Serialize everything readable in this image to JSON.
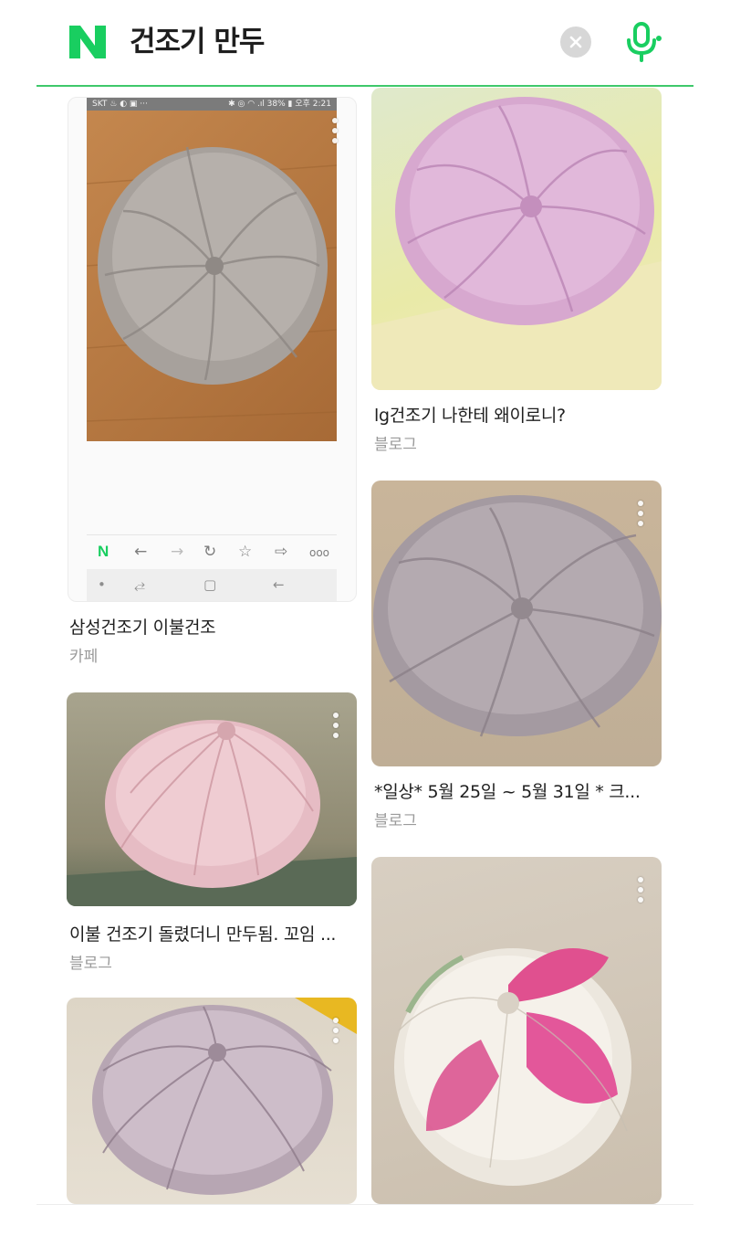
{
  "search": {
    "query": "건조기 만두",
    "brand_color": "#19ce60",
    "clear_icon": "clear-circle-icon",
    "mic_icon": "microphone-icon"
  },
  "results": [
    {
      "title": "삼성건조기 이불건조",
      "source": "카페",
      "screenshot": {
        "status_left": "SKT ♨ ◐ ▣  ···",
        "status_right": "✱ ◎ ◠ .ıl 38% ▮ 오후 2:21",
        "nav_icons": [
          "naver-n-icon",
          "back-arrow-icon",
          "forward-arrow-icon",
          "refresh-icon",
          "star-icon",
          "share-icon",
          "more-dots-icon"
        ],
        "system_icons": [
          "dot-icon",
          "recent-apps-icon",
          "home-square-icon",
          "system-back-icon"
        ]
      }
    },
    {
      "title": "lg건조기 나한테 왜이로니?",
      "source": "블로그"
    },
    {
      "title": "*일상* 5월 25일 ~ 5월 31일 * 크...",
      "source": "블로그"
    },
    {
      "title": "이불 건조기 돌렸더니 만두됨. 꼬임 ...",
      "source": "블로그"
    },
    {
      "title": "",
      "source": ""
    },
    {
      "title": "",
      "source": ""
    }
  ]
}
